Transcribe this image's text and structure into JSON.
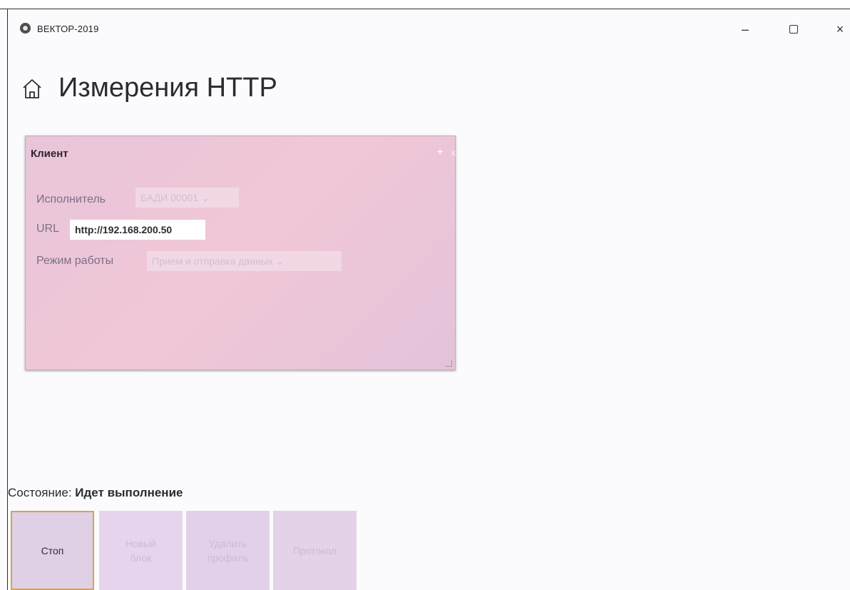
{
  "window": {
    "title": "ВЕКТОР-2019",
    "minimize_symbol": "–",
    "close_symbol": "×"
  },
  "page": {
    "title": "Измерения HTTP",
    "home_icon": "home-icon"
  },
  "client_block": {
    "title": "Клиент",
    "add_symbol": "+",
    "close_symbol": "x",
    "executor_label": "Исполнитель",
    "executor_value": "БАДИ 00001",
    "url_label": "URL",
    "url_value": "http://192.168.200.50",
    "mode_label": "Режим работы",
    "mode_value": "Прием и отправка данных"
  },
  "status": {
    "label": "Состояние:",
    "value": "Идет выполнение"
  },
  "buttons": {
    "stop": "Стоп",
    "new_block_line1": "Новый",
    "new_block_line2": "блок",
    "delete_profile_line1": "Удалить",
    "delete_profile_line2": "профиль",
    "protocol": "Протокол"
  },
  "colors": {
    "card_background": "#efc7d8",
    "button_background": "#e2d2e9",
    "focus_border": "#d6a44a"
  }
}
